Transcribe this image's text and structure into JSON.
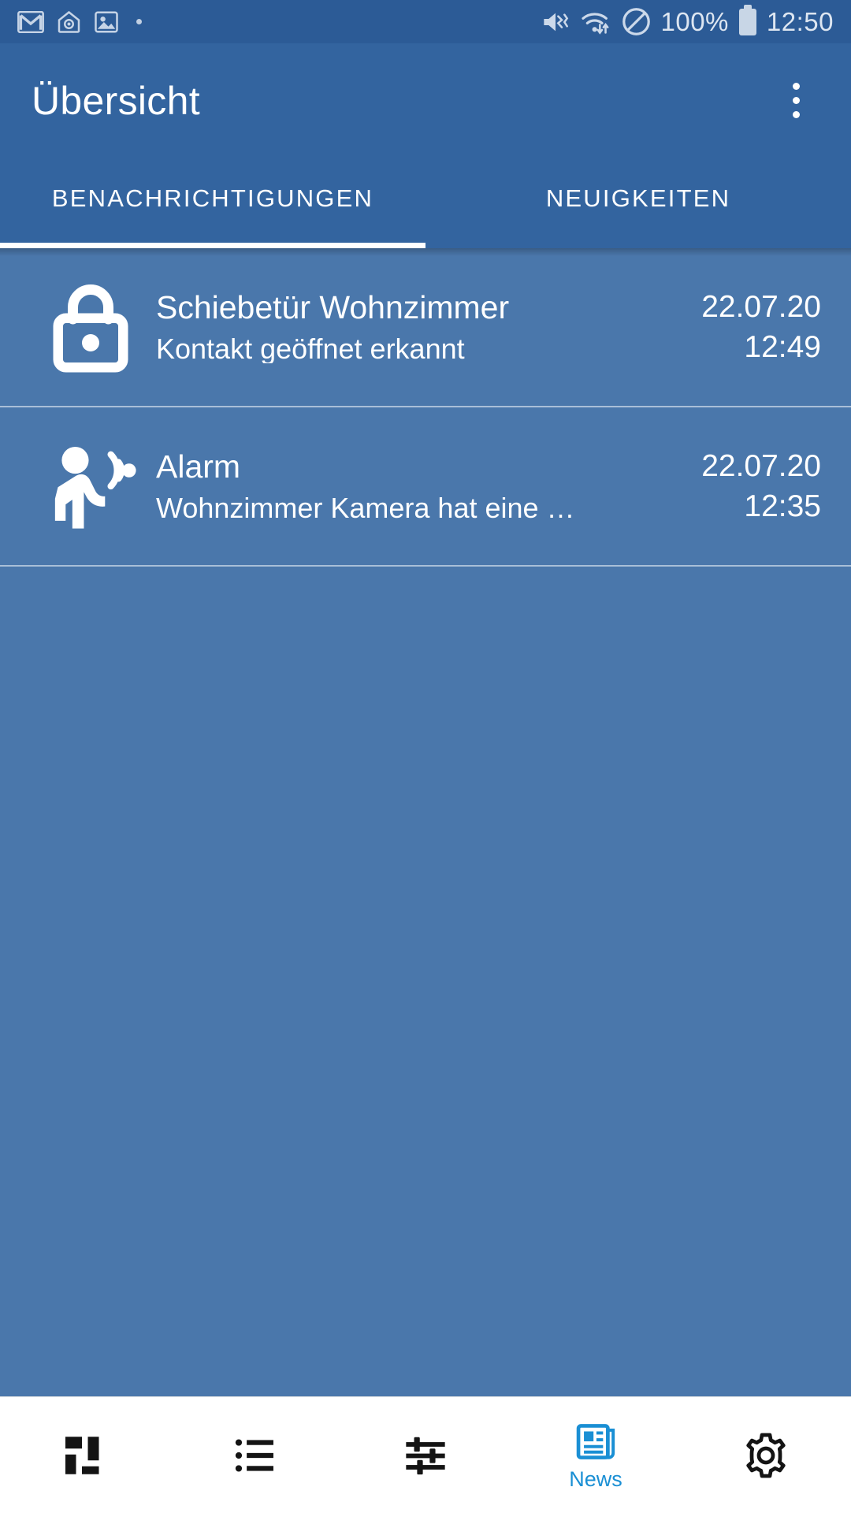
{
  "statusbar": {
    "left_icons": [
      "gmail-icon",
      "nest-home-icon",
      "gallery-image-icon",
      "more-notifications-dot"
    ],
    "right_icons": [
      "volume-mute-vibrate-icon",
      "wifi-data-transfer-icon",
      "do-not-disturb-icon",
      "battery-icon"
    ],
    "battery_label": "100%",
    "clock": "12:50",
    "background_color": "#2c5b96"
  },
  "appbar": {
    "title": "Übersicht",
    "overflow_menu": "overflow-menu-icon",
    "background_color": "#33649f"
  },
  "tabs": {
    "active_index": 0,
    "items": [
      {
        "label": "BENACHRICHTIGUNGEN"
      },
      {
        "label": "NEUIGKEITEN"
      }
    ]
  },
  "notifications": [
    {
      "icon": "lock-closed-icon",
      "title": "Schiebetür Wohnzimmer",
      "subtitle": "Kontakt geöffnet erkannt",
      "date": "22.07.20",
      "time": "12:49"
    },
    {
      "icon": "motion-detected-icon",
      "title": "Alarm",
      "subtitle": "Wohnzimmer Kamera hat eine …",
      "date": "22.07.20",
      "time": "12:35"
    }
  ],
  "bottomnav": {
    "active_index": 3,
    "active_color": "#1a8fd4",
    "inactive_color": "#1a1a1a",
    "items": [
      {
        "icon": "dashboard-tiles-icon",
        "label": ""
      },
      {
        "icon": "list-bullets-icon",
        "label": ""
      },
      {
        "icon": "sliders-settings-icon",
        "label": ""
      },
      {
        "icon": "news-paper-icon",
        "label": "News"
      },
      {
        "icon": "gear-settings-icon",
        "label": ""
      }
    ]
  }
}
